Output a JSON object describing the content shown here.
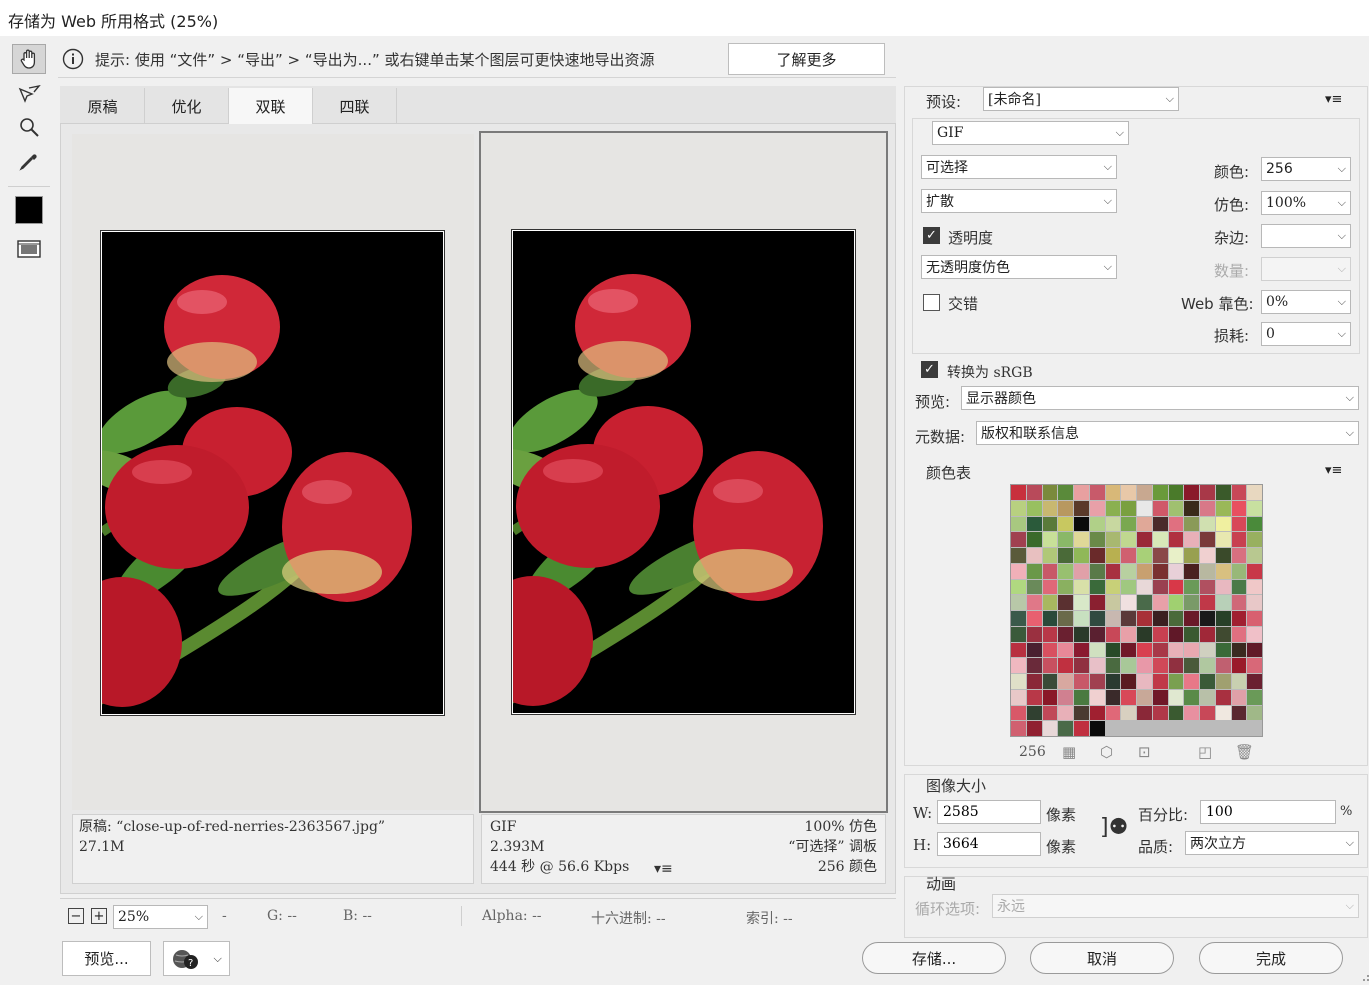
{
  "window": {
    "title": "存储为 Web 所用格式 (25%)"
  },
  "tip": {
    "text": "提示: 使用 “文件” > “导出” > “导出为...” 或右键单击某个图层可更快速地导出资源",
    "learn_more": "了解更多"
  },
  "tabs": [
    "原稿",
    "优化",
    "双联",
    "四联"
  ],
  "selected_tab": "双联",
  "original_pane": {
    "line1": "原稿: “close-up-of-red-nerries-2363567.jpg”",
    "line2": "27.1M"
  },
  "optimized_pane": {
    "format": "GIF",
    "size": "2.393M",
    "time": "444 秒 @ 56.6 Kbps",
    "dither": "100% 仿色",
    "palette": "“可选择” 调板",
    "colors": "256 颜色"
  },
  "status_bar": {
    "zoom": "25%",
    "r": "-",
    "g": "G: --",
    "b": "B: --",
    "alpha": "Alpha: --",
    "hex": "十六进制: --",
    "index": "索引: --"
  },
  "bottom": {
    "preview": "预览...",
    "save": "存储...",
    "cancel": "取消",
    "done": "完成"
  },
  "settings": {
    "preset_label": "预设:",
    "preset_value": "[未命名]",
    "format": "GIF",
    "reduction": "可选择",
    "dither_algo": "扩散",
    "transparency_label": "透明度",
    "transparency_checked": true,
    "transparency_dither": "无透明度仿色",
    "interlaced_label": "交错",
    "interlaced_checked": false,
    "colors_label": "颜色:",
    "colors_value": "256",
    "dither_label": "仿色:",
    "dither_value": "100%",
    "matte_label": "杂边:",
    "matte_value": "",
    "amount_label": "数量:",
    "amount_value": "",
    "web_snap_label": "Web 靠色:",
    "web_snap_value": "0%",
    "lossy_label": "损耗:",
    "lossy_value": "0",
    "convert_srgb_label": "转换为 sRGB",
    "convert_srgb_checked": true,
    "preview_label": "预览:",
    "preview_value": "显示器颜色",
    "metadata_label": "元数据:",
    "metadata_value": "版权和联系信息"
  },
  "color_table": {
    "title": "颜色表",
    "count": "256",
    "colors": [
      "#c8303d",
      "#b84a5a",
      "#7a8a3c",
      "#5a8a3a",
      "#e8a0a0",
      "#c85a6a",
      "#d8b878",
      "#e8c8a8",
      "#c8a890",
      "#6a9a3a",
      "#4a7a2a",
      "#8a1a2a",
      "#a83848",
      "#3a5a2a",
      "#c84858",
      "#e8d8c0",
      "#b8d080",
      "#98c060",
      "#c8b870",
      "#b89860",
      "#5a3a2a",
      "#e8a0a8",
      "#8ab050",
      "#7aa040",
      "#e8e8e8",
      "#d05868",
      "#a0c070",
      "#3a2a1a",
      "#d87888",
      "#9ab858",
      "#e85060",
      "#c8e0a0",
      "#a8c880",
      "#2a5a3a",
      "#5a7a3a",
      "#c8c860",
      "#0a0a0a",
      "#b0d088",
      "#c8d8a0",
      "#7aa850",
      "#e0a898",
      "#4a2a2a",
      "#e07080",
      "#8a9a58",
      "#d0e0b0",
      "#f0f0a0",
      "#d84858",
      "#4a8a3a",
      "#a04050",
      "#3a6a2a",
      "#c8e098",
      "#8ab868",
      "#e0d898",
      "#6a8a48",
      "#a8b870",
      "#c0d890",
      "#9a2838",
      "#d8e8b8",
      "#b03040",
      "#e8b0b8",
      "#7a3a3a",
      "#e8e8b0",
      "#c84050",
      "#98b060",
      "#5a5a3a",
      "#e8c0c0",
      "#b0c878",
      "#4a6a38",
      "#90b858",
      "#6a2a2a",
      "#b8b050",
      "#d06070",
      "#a8d078",
      "#8a4848",
      "#e8f0c8",
      "#98a050",
      "#f0d0d0",
      "#3a4a2a",
      "#d87080",
      "#b8c890",
      "#f0b0b8",
      "#6a9848",
      "#c85868",
      "#98c070",
      "#e0a0a8",
      "#5a7a48",
      "#a83040",
      "#b8d0a0",
      "#c8a070",
      "#7a3030",
      "#e8d0d8",
      "#4a2020",
      "#b8b8a0",
      "#d8c080",
      "#98b878",
      "#c83848",
      "#b0d880",
      "#6a8a5a",
      "#e06878",
      "#8ab060",
      "#d8e0a8",
      "#3a6a3a",
      "#c8d078",
      "#a0c880",
      "#e8d8d8",
      "#9a4050",
      "#d83848",
      "#6a9a58",
      "#b05060",
      "#e8b8c0",
      "#4a7a48",
      "#f0c8c8",
      "#b8c8a8",
      "#e07888",
      "#a8b860",
      "#5a3030",
      "#d8e8c8",
      "#8a2030",
      "#c8c8a0",
      "#f0e0e0",
      "#4a6a4a",
      "#e8a0a8",
      "#a0d070",
      "#7a9a68",
      "#c03848",
      "#b8d0b8",
      "#d06878",
      "#e8c8c8",
      "#3a5a4a",
      "#e86070",
      "#2a4a3a",
      "#6a6a4a",
      "#c8e0c0",
      "#304a40",
      "#c8b8b0",
      "#5a3a3a",
      "#a83038",
      "#3a2020",
      "#4a6a3a",
      "#6a1a28",
      "#1a1a1a",
      "#284028",
      "#a02030",
      "#d86070",
      "#3a5a3a",
      "#9a3040",
      "#b83848",
      "#6a2030",
      "#2a3a2a",
      "#5a2030",
      "#c84858",
      "#e8a0a8",
      "#2a3a28",
      "#c84050",
      "#601828",
      "#3a5a30",
      "#a02838",
      "#404a30",
      "#e07080",
      "#f0c0c8",
      "#b83040",
      "#4a2030",
      "#d85060",
      "#e88898",
      "#8a1a30",
      "#d0e0c0",
      "#284a28",
      "#701828",
      "#d84050",
      "#a83848",
      "#e8b0b8",
      "#e8a8b0",
      "#d0d0c0",
      "#3a6a38",
      "#3a2a20",
      "#601a28",
      "#f0b8c0",
      "#6a2a3a",
      "#c85060",
      "#c03040",
      "#903040",
      "#e8c0c8",
      "#4a6a40",
      "#a8c898",
      "#e898a8",
      "#d04858",
      "#903040",
      "#4a5a3a",
      "#b0c8a0",
      "#c06070",
      "#9a1a2a",
      "#d86878",
      "#e0e0c8",
      "#8a2838",
      "#3a4a38",
      "#d8a8a0",
      "#c85868",
      "#a04050",
      "#2a3a30",
      "#5a1a20",
      "#e8b8c0",
      "#c03848",
      "#7aa050",
      "#e87888",
      "#3a5a38",
      "#a0a070",
      "#c8d0b0",
      "#6a2030",
      "#e8c8c8",
      "#b83848",
      "#8a1828",
      "#d08090",
      "#4a7a40",
      "#f0d0d0",
      "#3a2a2a",
      "#d84858",
      "#c8a898",
      "#701828",
      "#e0e8d0",
      "#5a8a48",
      "#b8c0a8",
      "#a83040",
      "#e0a0a8",
      "#6a9a58",
      "#d85868",
      "#304030",
      "#c04858",
      "#e8b0b8",
      "#4a3a30",
      "#a02030",
      "#e06878",
      "#d8d0c0",
      "#8a2838",
      "#b03848",
      "#3a5a30",
      "#e890a0",
      "#c84858",
      "#f0e8e0",
      "#5a2830",
      "#a0b888",
      "#d06070",
      "#902030",
      "#e8d8d8",
      "#4a6a48",
      "#c03040",
      "#0a0a0a"
    ]
  }
}
